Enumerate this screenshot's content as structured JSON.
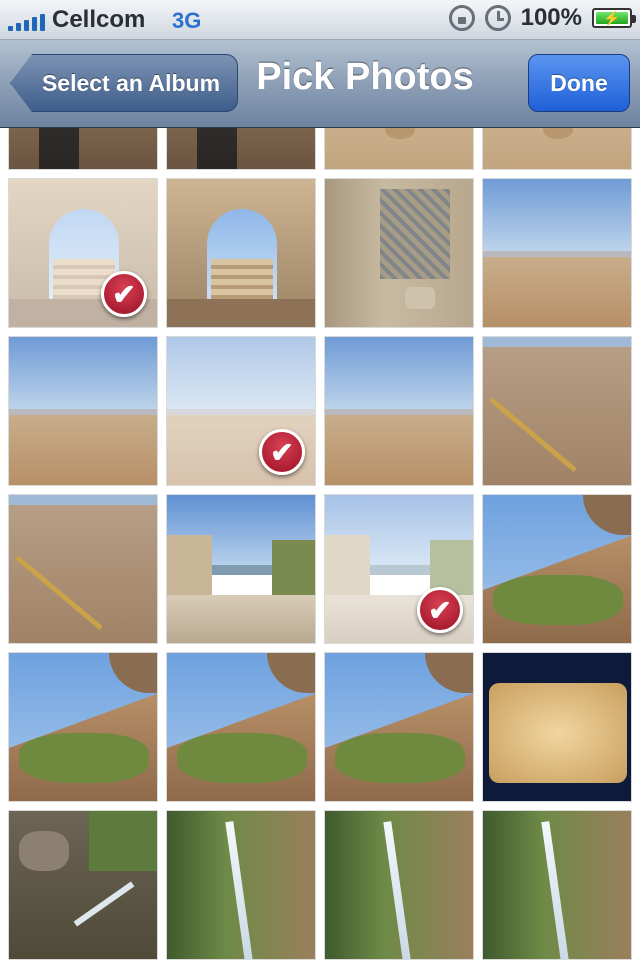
{
  "status_bar": {
    "carrier": "Cellcom",
    "network": "3G",
    "battery_percent": "100%",
    "battery_level": 1.0,
    "signal_bars": 5
  },
  "nav_bar": {
    "back_label": "Select an Album",
    "title": "Pick Photos",
    "done_label": "Done"
  },
  "colors": {
    "done_button": "#1f5fd8",
    "check_badge": "#b3142e",
    "nav_bar": "#8d9fb6"
  },
  "photos": [
    {
      "scene": "person-rock",
      "selected": false
    },
    {
      "scene": "person-rock",
      "selected": false
    },
    {
      "scene": "desert-craters",
      "selected": false
    },
    {
      "scene": "desert-craters",
      "selected": false
    },
    {
      "scene": "stone-arch",
      "selected": true
    },
    {
      "scene": "stone-arch",
      "selected": false
    },
    {
      "scene": "mosaic-wall",
      "selected": false
    },
    {
      "scene": "desert-horizon",
      "selected": false
    },
    {
      "scene": "desert-horizon",
      "selected": false
    },
    {
      "scene": "desert-horizon",
      "selected": true
    },
    {
      "scene": "desert-horizon",
      "selected": false
    },
    {
      "scene": "cliff-railing",
      "selected": false
    },
    {
      "scene": "cliff-railing",
      "selected": false
    },
    {
      "scene": "canyon-sea",
      "selected": false
    },
    {
      "scene": "canyon-sea",
      "selected": true
    },
    {
      "scene": "cave-cliff",
      "selected": false
    },
    {
      "scene": "cave-cliff",
      "selected": false
    },
    {
      "scene": "cave-cliff",
      "selected": false
    },
    {
      "scene": "cave-cliff",
      "selected": false
    },
    {
      "scene": "aerial-desert",
      "selected": false
    },
    {
      "scene": "stream-rocks",
      "selected": false
    },
    {
      "scene": "waterfall",
      "selected": false
    },
    {
      "scene": "waterfall",
      "selected": false
    },
    {
      "scene": "waterfall",
      "selected": false
    }
  ]
}
